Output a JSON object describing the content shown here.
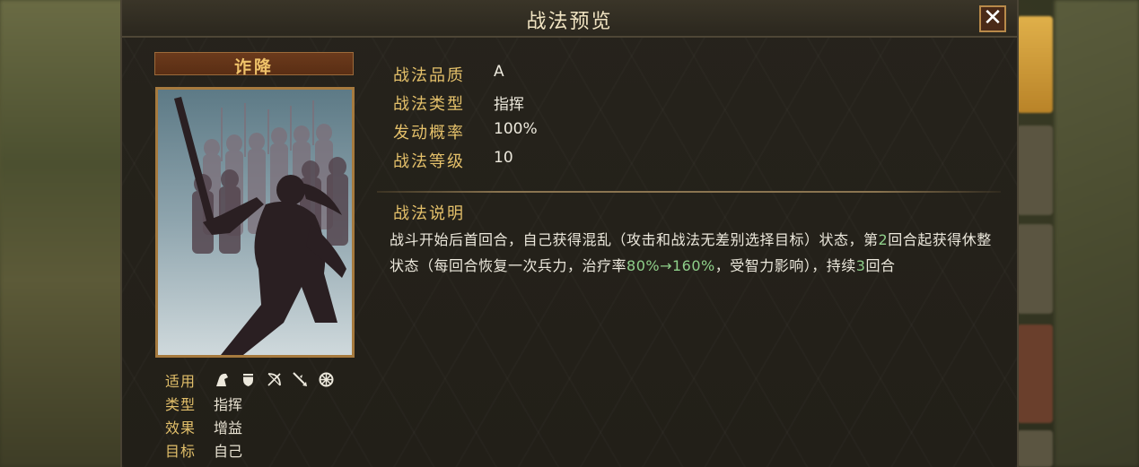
{
  "dialog": {
    "title": "战法预览",
    "close_symbol": "✕"
  },
  "skill": {
    "name": "诈降"
  },
  "attributes": [
    {
      "label": "战法品质",
      "value": "A"
    },
    {
      "label": "战法类型",
      "value": "指挥"
    },
    {
      "label": "发动概率",
      "value": "100%"
    },
    {
      "label": "战法等级",
      "value": "10"
    }
  ],
  "description": {
    "title": "战法说明",
    "parts": [
      {
        "text": "战斗开始后首回合，自己获得混乱（攻击和战法无差别选择目标）状态，第",
        "highlight": false
      },
      {
        "text": "2",
        "highlight": true
      },
      {
        "text": "回合起获得休整状态（每回合恢复一次兵力，治疗率",
        "highlight": false
      },
      {
        "text": "80%→160%",
        "highlight": true
      },
      {
        "text": "，受智力影响），持续",
        "highlight": false
      },
      {
        "text": "3",
        "highlight": true
      },
      {
        "text": "回合",
        "highlight": false
      }
    ]
  },
  "meta": {
    "applicable_label": "适用",
    "applicable_icons": [
      "cavalry-icon",
      "shield-icon",
      "archer-icon",
      "spear-icon",
      "siege-icon"
    ],
    "type_label": "类型",
    "type_value": "指挥",
    "effect_label": "效果",
    "effect_value": "增益",
    "target_label": "目标",
    "target_value": "自己"
  },
  "colors": {
    "gold_label": "#e4c06a",
    "highlight_green": "#8fd08a",
    "name_bar": "#6b3a1c"
  }
}
